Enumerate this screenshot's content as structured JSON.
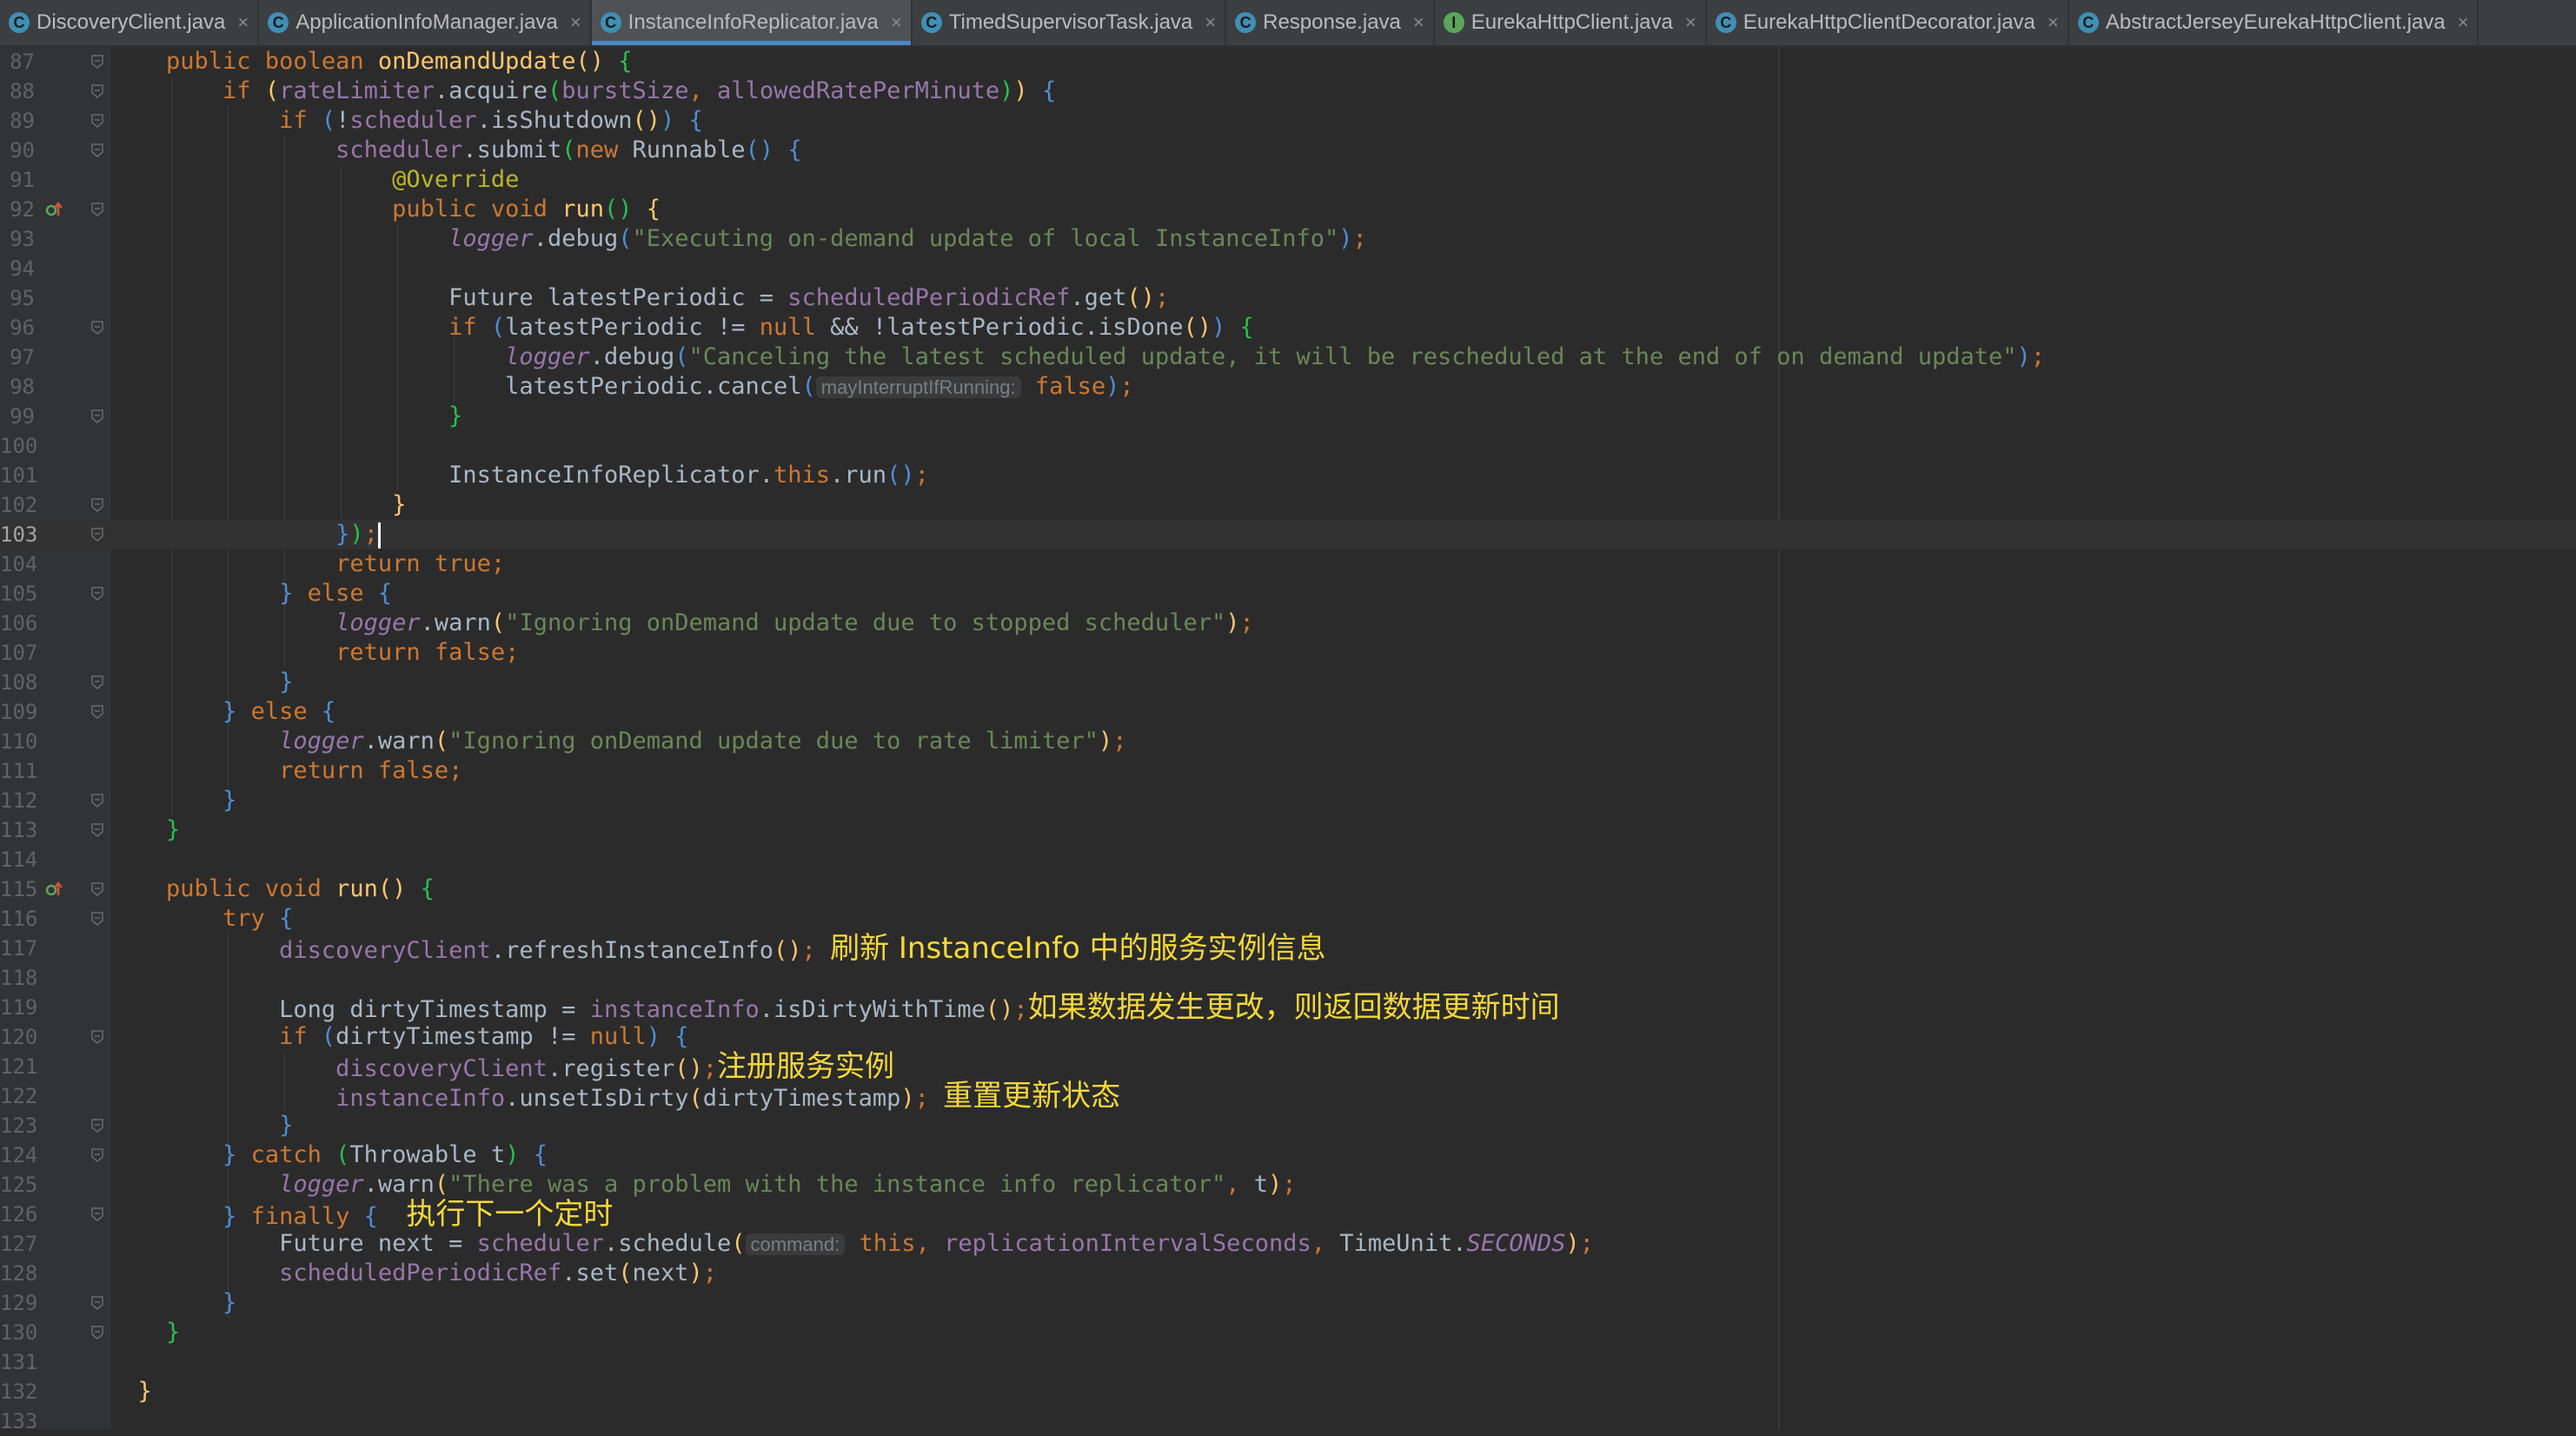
{
  "tabs": [
    {
      "label": "DiscoveryClient.java",
      "icon": "class-icon",
      "active": false
    },
    {
      "label": "ApplicationInfoManager.java",
      "icon": "class-icon",
      "active": false
    },
    {
      "label": "InstanceInfoReplicator.java",
      "icon": "class-icon",
      "active": true
    },
    {
      "label": "TimedSupervisorTask.java",
      "icon": "class-icon",
      "active": false
    },
    {
      "label": "Response.java",
      "icon": "class-icon",
      "active": false
    },
    {
      "label": "EurekaHttpClient.java",
      "icon": "interface-icon",
      "active": false
    },
    {
      "label": "EurekaHttpClientDecorator.java",
      "icon": "class-icon",
      "active": false
    },
    {
      "label": "AbstractJerseyEurekaHttpClient.java",
      "icon": "class-icon",
      "active": false
    }
  ],
  "tab_close_glyph": "×",
  "tab_icon_glyph": "C",
  "tab_iface_glyph": "I",
  "current_line": 103,
  "colors": {
    "keyword": "#cc7832",
    "method": "#ffc66d",
    "field": "#9876aa",
    "string": "#6a8759",
    "annotation": "#bbb529",
    "comment_note": "#f5d73b",
    "active_tab_accent": "#4a88c7"
  },
  "lines": [
    {
      "n": 87,
      "fold": true,
      "tokens": [
        [
          "",
          "    "
        ],
        [
          "kw",
          "public boolean "
        ],
        [
          "fn",
          "onDemandUpdate"
        ],
        [
          "br1",
          "()"
        ],
        [
          "pa",
          " "
        ],
        [
          "br2",
          "{"
        ]
      ]
    },
    {
      "n": 88,
      "fold": true,
      "tokens": [
        [
          "",
          "        "
        ],
        [
          "kw",
          "if "
        ],
        [
          "br1",
          "("
        ],
        [
          "fld",
          "rateLimiter"
        ],
        [
          "pa",
          ".acquire"
        ],
        [
          "br2",
          "("
        ],
        [
          "fld",
          "burstSize"
        ],
        [
          "kw",
          ", "
        ],
        [
          "fld",
          "allowedRatePerMinute"
        ],
        [
          "br2",
          ")"
        ],
        [
          "br1",
          ")"
        ],
        [
          "pa",
          " "
        ],
        [
          "br3",
          "{"
        ]
      ]
    },
    {
      "n": 89,
      "fold": true,
      "tokens": [
        [
          "",
          "            "
        ],
        [
          "kw",
          "if "
        ],
        [
          "br3",
          "("
        ],
        [
          "pa",
          "!"
        ],
        [
          "fld",
          "scheduler"
        ],
        [
          "pa",
          ".isShutdown"
        ],
        [
          "br1",
          "()"
        ],
        [
          "br3",
          ")"
        ],
        [
          "pa",
          " "
        ],
        [
          "br3",
          "{"
        ]
      ]
    },
    {
      "n": 90,
      "fold": true,
      "tokens": [
        [
          "",
          "                "
        ],
        [
          "fld",
          "scheduler"
        ],
        [
          "pa",
          ".submit"
        ],
        [
          "br2",
          "("
        ],
        [
          "kw",
          "new "
        ],
        [
          "pa",
          "Runnable"
        ],
        [
          "br3",
          "()"
        ],
        [
          "pa",
          " "
        ],
        [
          "br3",
          "{"
        ]
      ]
    },
    {
      "n": 91,
      "fold": false,
      "tokens": [
        [
          "",
          "                    "
        ],
        [
          "ann",
          "@Override"
        ]
      ]
    },
    {
      "n": 92,
      "fold": true,
      "marker": true,
      "tokens": [
        [
          "",
          "                    "
        ],
        [
          "kw",
          "public void "
        ],
        [
          "fn",
          "run"
        ],
        [
          "br2",
          "()"
        ],
        [
          "pa",
          " "
        ],
        [
          "br1",
          "{"
        ]
      ]
    },
    {
      "n": 93,
      "fold": false,
      "tokens": [
        [
          "",
          "                        "
        ],
        [
          "fld-i",
          "logger"
        ],
        [
          "pa",
          ".debug"
        ],
        [
          "br3",
          "("
        ],
        [
          "str",
          "\"Executing on-demand update of local InstanceInfo\""
        ],
        [
          "br3",
          ")"
        ],
        [
          "kw",
          ";"
        ]
      ]
    },
    {
      "n": 94,
      "fold": false,
      "tokens": []
    },
    {
      "n": 95,
      "fold": false,
      "tokens": [
        [
          "",
          "                        "
        ],
        [
          "pa",
          "Future latestPeriodic = "
        ],
        [
          "fld",
          "scheduledPeriodicRef"
        ],
        [
          "pa",
          ".get"
        ],
        [
          "br1",
          "()"
        ],
        [
          "kw",
          ";"
        ]
      ]
    },
    {
      "n": 96,
      "fold": true,
      "tokens": [
        [
          "",
          "                        "
        ],
        [
          "kw",
          "if "
        ],
        [
          "br3",
          "("
        ],
        [
          "pa",
          "latestPeriodic != "
        ],
        [
          "kw",
          "null "
        ],
        [
          "pa",
          "&& !latestPeriodic.isDone"
        ],
        [
          "br1",
          "()"
        ],
        [
          "br3",
          ")"
        ],
        [
          "pa",
          " "
        ],
        [
          "br2",
          "{"
        ]
      ]
    },
    {
      "n": 97,
      "fold": false,
      "tokens": [
        [
          "",
          "                            "
        ],
        [
          "fld-i",
          "logger"
        ],
        [
          "pa",
          ".debug"
        ],
        [
          "br3",
          "("
        ],
        [
          "str",
          "\"Canceling the latest scheduled update, it will be rescheduled at the end of on demand update\""
        ],
        [
          "br3",
          ")"
        ],
        [
          "kw",
          ";"
        ]
      ]
    },
    {
      "n": 98,
      "fold": false,
      "tokens": [
        [
          "",
          "                            "
        ],
        [
          "pa",
          "latestPeriodic.cancel"
        ],
        [
          "br3",
          "("
        ],
        [
          "hint",
          "mayInterruptIfRunning:"
        ],
        [
          "pa",
          " "
        ],
        [
          "kw",
          "false"
        ],
        [
          "br3",
          ")"
        ],
        [
          "kw",
          ";"
        ]
      ]
    },
    {
      "n": 99,
      "fold": true,
      "tokens": [
        [
          "",
          "                        "
        ],
        [
          "br2",
          "}"
        ]
      ]
    },
    {
      "n": 100,
      "fold": false,
      "tokens": []
    },
    {
      "n": 101,
      "fold": false,
      "tokens": [
        [
          "",
          "                        "
        ],
        [
          "pa",
          "InstanceInfoReplicator."
        ],
        [
          "kw",
          "this"
        ],
        [
          "pa",
          ".run"
        ],
        [
          "br3",
          "()"
        ],
        [
          "kw",
          ";"
        ]
      ]
    },
    {
      "n": 102,
      "fold": true,
      "tokens": [
        [
          "",
          "                    "
        ],
        [
          "br1",
          "}"
        ]
      ]
    },
    {
      "n": 103,
      "fold": true,
      "caret": true,
      "tokens": [
        [
          "",
          "                "
        ],
        [
          "br3",
          "}"
        ],
        [
          "br2",
          ")"
        ],
        [
          "kw",
          ";"
        ]
      ]
    },
    {
      "n": 104,
      "fold": false,
      "tokens": [
        [
          "",
          "                "
        ],
        [
          "kw",
          "return true;"
        ]
      ]
    },
    {
      "n": 105,
      "fold": true,
      "tokens": [
        [
          "",
          "            "
        ],
        [
          "br3",
          "}"
        ],
        [
          "pa",
          " "
        ],
        [
          "kw",
          "else "
        ],
        [
          "br3",
          "{"
        ]
      ]
    },
    {
      "n": 106,
      "fold": false,
      "tokens": [
        [
          "",
          "                "
        ],
        [
          "fld-i",
          "logger"
        ],
        [
          "pa",
          ".warn"
        ],
        [
          "br1",
          "("
        ],
        [
          "str",
          "\"Ignoring onDemand update due to stopped scheduler\""
        ],
        [
          "br1",
          ")"
        ],
        [
          "kw",
          ";"
        ]
      ]
    },
    {
      "n": 107,
      "fold": false,
      "tokens": [
        [
          "",
          "                "
        ],
        [
          "kw",
          "return false;"
        ]
      ]
    },
    {
      "n": 108,
      "fold": true,
      "tokens": [
        [
          "",
          "            "
        ],
        [
          "br3",
          "}"
        ]
      ]
    },
    {
      "n": 109,
      "fold": true,
      "tokens": [
        [
          "",
          "        "
        ],
        [
          "br3",
          "}"
        ],
        [
          "pa",
          " "
        ],
        [
          "kw",
          "else "
        ],
        [
          "br3",
          "{"
        ]
      ]
    },
    {
      "n": 110,
      "fold": false,
      "tokens": [
        [
          "",
          "            "
        ],
        [
          "fld-i",
          "logger"
        ],
        [
          "pa",
          ".warn"
        ],
        [
          "br1",
          "("
        ],
        [
          "str",
          "\"Ignoring onDemand update due to rate limiter\""
        ],
        [
          "br1",
          ")"
        ],
        [
          "kw",
          ";"
        ]
      ]
    },
    {
      "n": 111,
      "fold": false,
      "tokens": [
        [
          "",
          "            "
        ],
        [
          "kw",
          "return false;"
        ]
      ]
    },
    {
      "n": 112,
      "fold": true,
      "tokens": [
        [
          "",
          "        "
        ],
        [
          "br3",
          "}"
        ]
      ]
    },
    {
      "n": 113,
      "fold": true,
      "tokens": [
        [
          "",
          "    "
        ],
        [
          "br2",
          "}"
        ]
      ]
    },
    {
      "n": 114,
      "fold": false,
      "tokens": []
    },
    {
      "n": 115,
      "fold": true,
      "marker": true,
      "tokens": [
        [
          "",
          "    "
        ],
        [
          "kw",
          "public void "
        ],
        [
          "fn",
          "run"
        ],
        [
          "br1",
          "()"
        ],
        [
          "pa",
          " "
        ],
        [
          "br2",
          "{"
        ]
      ]
    },
    {
      "n": 116,
      "fold": true,
      "tokens": [
        [
          "",
          "        "
        ],
        [
          "kw",
          "try "
        ],
        [
          "br3",
          "{"
        ]
      ]
    },
    {
      "n": 117,
      "fold": false,
      "tokens": [
        [
          "",
          "            "
        ],
        [
          "fld",
          "discoveryClient"
        ],
        [
          "pa",
          ".refreshInstanceInfo"
        ],
        [
          "br1",
          "()"
        ],
        [
          "kw",
          ";"
        ],
        [
          "pa",
          " "
        ],
        [
          "note",
          "刷新 InstanceInfo 中的服务实例信息"
        ]
      ]
    },
    {
      "n": 118,
      "fold": false,
      "tokens": []
    },
    {
      "n": 119,
      "fold": false,
      "tokens": [
        [
          "",
          "            "
        ],
        [
          "pa",
          "Long dirtyTimestamp = "
        ],
        [
          "fld",
          "instanceInfo"
        ],
        [
          "pa",
          ".isDirtyWithTime"
        ],
        [
          "br1",
          "()"
        ],
        [
          "kw",
          ";"
        ],
        [
          "note",
          "如果数据发生更改，则返回数据更新时间"
        ]
      ]
    },
    {
      "n": 120,
      "fold": true,
      "tokens": [
        [
          "",
          "            "
        ],
        [
          "kw",
          "if "
        ],
        [
          "br3",
          "("
        ],
        [
          "pa",
          "dirtyTimestamp != "
        ],
        [
          "kw",
          "null"
        ],
        [
          "br3",
          ")"
        ],
        [
          "pa",
          " "
        ],
        [
          "br3",
          "{"
        ]
      ]
    },
    {
      "n": 121,
      "fold": false,
      "tokens": [
        [
          "",
          "                "
        ],
        [
          "fld",
          "discoveryClient"
        ],
        [
          "pa",
          ".register"
        ],
        [
          "br1",
          "()"
        ],
        [
          "kw",
          ";"
        ],
        [
          "note",
          "注册服务实例"
        ]
      ]
    },
    {
      "n": 122,
      "fold": false,
      "tokens": [
        [
          "",
          "                "
        ],
        [
          "fld",
          "instanceInfo"
        ],
        [
          "pa",
          ".unsetIsDirty"
        ],
        [
          "br1",
          "("
        ],
        [
          "pa",
          "dirtyTimestamp"
        ],
        [
          "br1",
          ")"
        ],
        [
          "kw",
          ";"
        ],
        [
          "pa",
          " "
        ],
        [
          "note",
          "重置更新状态"
        ]
      ]
    },
    {
      "n": 123,
      "fold": true,
      "tokens": [
        [
          "",
          "            "
        ],
        [
          "br3",
          "}"
        ]
      ]
    },
    {
      "n": 124,
      "fold": true,
      "tokens": [
        [
          "",
          "        "
        ],
        [
          "br3",
          "}"
        ],
        [
          "pa",
          " "
        ],
        [
          "kw",
          "catch "
        ],
        [
          "br2",
          "("
        ],
        [
          "pa",
          "Throwable t"
        ],
        [
          "br2",
          ")"
        ],
        [
          "pa",
          " "
        ],
        [
          "br3",
          "{"
        ]
      ]
    },
    {
      "n": 125,
      "fold": false,
      "tokens": [
        [
          "",
          "            "
        ],
        [
          "fld-i",
          "logger"
        ],
        [
          "pa",
          ".warn"
        ],
        [
          "br1",
          "("
        ],
        [
          "str",
          "\"There was a problem with the instance info replicator\""
        ],
        [
          "kw",
          ", "
        ],
        [
          "pa",
          "t"
        ],
        [
          "br1",
          ")"
        ],
        [
          "kw",
          ";"
        ]
      ]
    },
    {
      "n": 126,
      "fold": true,
      "tokens": [
        [
          "",
          "        "
        ],
        [
          "br3",
          "}"
        ],
        [
          "pa",
          " "
        ],
        [
          "kw",
          "finally "
        ],
        [
          "br3",
          "{"
        ],
        [
          "pa",
          "  "
        ],
        [
          "note",
          "执行下一个定时"
        ]
      ]
    },
    {
      "n": 127,
      "fold": false,
      "tokens": [
        [
          "",
          "            "
        ],
        [
          "pa",
          "Future next = "
        ],
        [
          "fld",
          "scheduler"
        ],
        [
          "pa",
          ".schedule"
        ],
        [
          "br1",
          "("
        ],
        [
          "hint",
          "command:"
        ],
        [
          "pa",
          " "
        ],
        [
          "kw",
          "this, "
        ],
        [
          "fld",
          "replicationIntervalSeconds"
        ],
        [
          "kw",
          ", "
        ],
        [
          "pa",
          "TimeUnit."
        ],
        [
          "fld-i",
          "SECONDS"
        ],
        [
          "br1",
          ")"
        ],
        [
          "kw",
          ";"
        ]
      ]
    },
    {
      "n": 128,
      "fold": false,
      "tokens": [
        [
          "",
          "            "
        ],
        [
          "fld",
          "scheduledPeriodicRef"
        ],
        [
          "pa",
          ".set"
        ],
        [
          "br1",
          "("
        ],
        [
          "pa",
          "next"
        ],
        [
          "br1",
          ")"
        ],
        [
          "kw",
          ";"
        ]
      ]
    },
    {
      "n": 129,
      "fold": true,
      "tokens": [
        [
          "",
          "        "
        ],
        [
          "br3",
          "}"
        ]
      ]
    },
    {
      "n": 130,
      "fold": true,
      "tokens": [
        [
          "",
          "    "
        ],
        [
          "br2",
          "}"
        ]
      ]
    },
    {
      "n": 131,
      "fold": false,
      "tokens": []
    },
    {
      "n": 132,
      "fold": false,
      "tokens": [
        [
          "",
          "  "
        ],
        [
          "br1",
          "}"
        ]
      ]
    },
    {
      "n": 133,
      "fold": false,
      "tokens": []
    }
  ]
}
